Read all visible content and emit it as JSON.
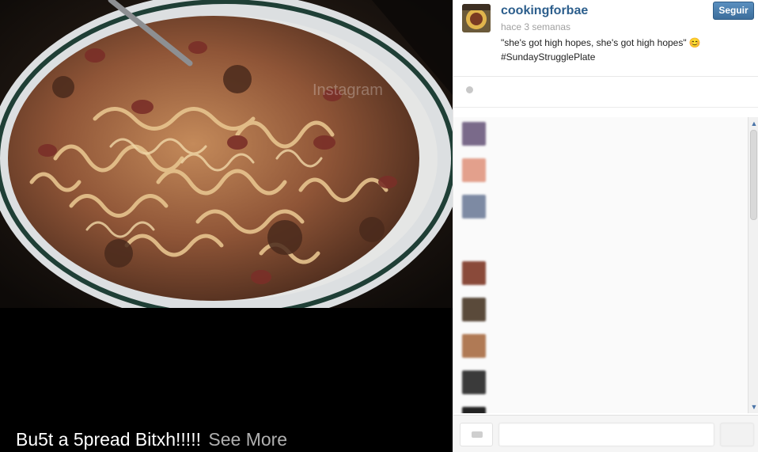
{
  "post": {
    "caption_overlay": "Bu5t a 5pread Bitxh!!!!!",
    "see_more": "See More",
    "watermark": "Instagram"
  },
  "header": {
    "username": "cookingforbae",
    "time_ago": "hace 3 semanas",
    "caption_line1": "\"she's got high hopes, she's got high hopes\" 😊",
    "caption_line2": "#SundayStrugglePlate",
    "follow_label": "Seguir"
  },
  "likes": {
    "text": "",
    "subtext": ""
  },
  "comments": [
    {
      "user": "",
      "text": "",
      "avatar_color": "#7a6a8a"
    },
    {
      "user": "",
      "text": "",
      "avatar_color": "#e3a08c"
    },
    {
      "user": "",
      "text": "",
      "avatar_color": "#7d8aa3"
    },
    {
      "user": "",
      "text": "",
      "avatar_color": "#8a4a3a"
    },
    {
      "user": "",
      "text": "",
      "avatar_color": "#5a4a3a"
    },
    {
      "user": "",
      "text": "",
      "avatar_color": "#b07a55"
    },
    {
      "user": "",
      "text": "",
      "avatar_color": "#3a3a3a"
    },
    {
      "user": "",
      "text": "",
      "avatar_color": "#222222"
    }
  ],
  "composer": {
    "placeholder": "",
    "send_label": ""
  },
  "colors": {
    "accent": "#2c5e8c",
    "follow_button": "#4a7fb0"
  }
}
